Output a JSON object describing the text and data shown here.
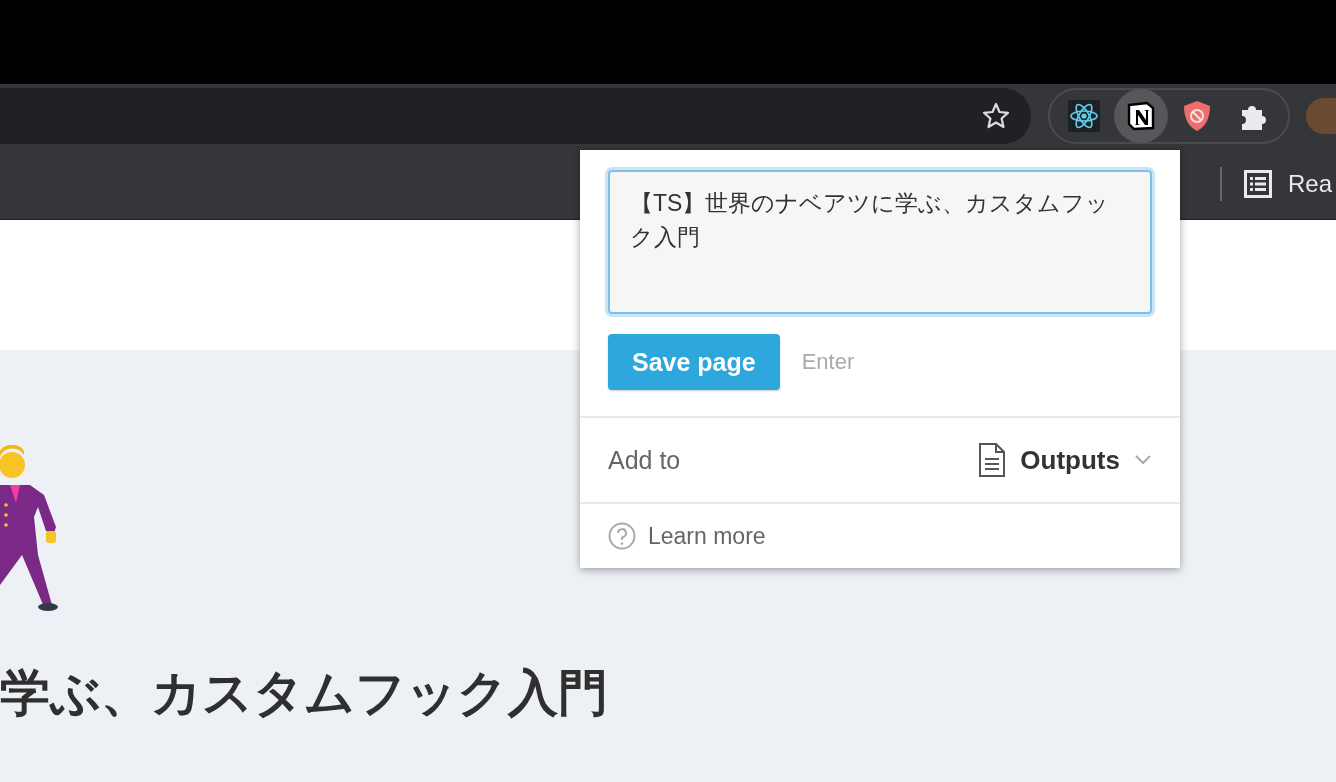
{
  "extensions": [
    {
      "kind": "react",
      "selected": false
    },
    {
      "kind": "notion",
      "selected": true
    },
    {
      "kind": "blocker",
      "selected": false
    },
    {
      "kind": "puzzle",
      "selected": false
    }
  ],
  "bookmarks_bar": {
    "reading_list": "Rea"
  },
  "page": {
    "title": "学ぶ、カスタムフック入門"
  },
  "popup": {
    "title_field": {
      "value": "【TS】世界のナベアツに学ぶ、カスタムフック入門"
    },
    "save_button": "Save page",
    "shortcut_hint": "Enter",
    "add_to": {
      "label": "Add to",
      "target": "Outputs"
    },
    "learn_more": "Learn more"
  }
}
